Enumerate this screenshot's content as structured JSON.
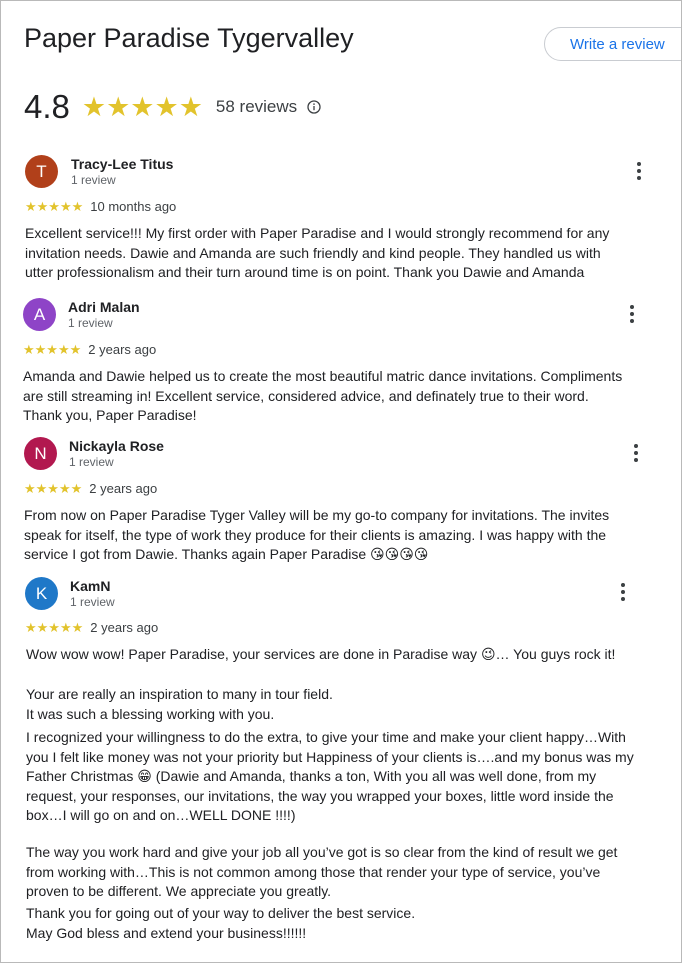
{
  "place": {
    "title": "Paper Paradise Tygervalley",
    "write_review_label": "Write a review",
    "rating": "4.8",
    "stars": "★★★★★",
    "review_count": "58 reviews"
  },
  "reviews": [
    {
      "initial": "T",
      "avatar_color": "#b1401a",
      "name": "Tracy-Lee Titus",
      "meta": "1 review",
      "stars": "★★★★★",
      "time": "10 months ago",
      "text": "Excellent service!!! My first order with Paper Paradise and I would strongly recommend for any\ninvitation needs. Dawie and Amanda are such friendly and kind people. They handled us with\nutter professionalism and their turn around time is on point. Thank you Dawie and Amanda"
    },
    {
      "initial": "A",
      "avatar_color": "#8e44c7",
      "name": "Adri Malan",
      "meta": "1 review",
      "stars": "★★★★★",
      "time": "2 years ago",
      "text": "Amanda and Dawie helped us to create the most beautiful matric dance invitations. Compliments\nare still streaming in! Excellent service, considered advice, and definately true to their word.\nThank you, Paper Paradise!"
    },
    {
      "initial": "N",
      "avatar_color": "#b2184f",
      "name": "Nickayla Rose",
      "meta": "1 review",
      "stars": "★★★★★",
      "time": "2 years ago",
      "text": "From now on Paper Paradise Tyger Valley will be my go-to company for invitations. The invites\nspeak for itself, the type of work they produce for their clients is amazing. I was happy with the\nservice I got from Dawie. Thanks again Paper Paradise 😘😘😘😘"
    },
    {
      "initial": "K",
      "avatar_color": "#1f78c8",
      "name": "KamN",
      "meta": "1 review",
      "stars": "★★★★★",
      "time": "2 years ago",
      "text_p1": "Wow wow wow! Paper Paradise, your services are done in Paradise way 😉… You guys rock it!",
      "text_p2": "Your are really an inspiration to many in tour field.\nIt was such a blessing working with you.",
      "text_p3": "I recognized your willingness to do the extra, to give your time and make your client happy…With\nyou I felt like money was not your priority but Happiness of your clients is….and my bonus was my\nFather Christmas 😁 (Dawie and Amanda, thanks a ton, With you all was well done, from my\nrequest, your responses, our invitations, the way you wrapped your boxes, little word inside the\nbox…I will go on and on…WELL DONE !!!!)",
      "text_p4": "The way you work hard and give your job all you’ve got is so clear from the kind of result we get\nfrom working with…This is not common among those that render your type of service, you’ve\nproven to be different. We appreciate you greatly.",
      "text_p5": "Thank you for going out of your way to deliver the best service.",
      "text_p6": "May God bless and extend your business!!!!!!"
    }
  ]
}
